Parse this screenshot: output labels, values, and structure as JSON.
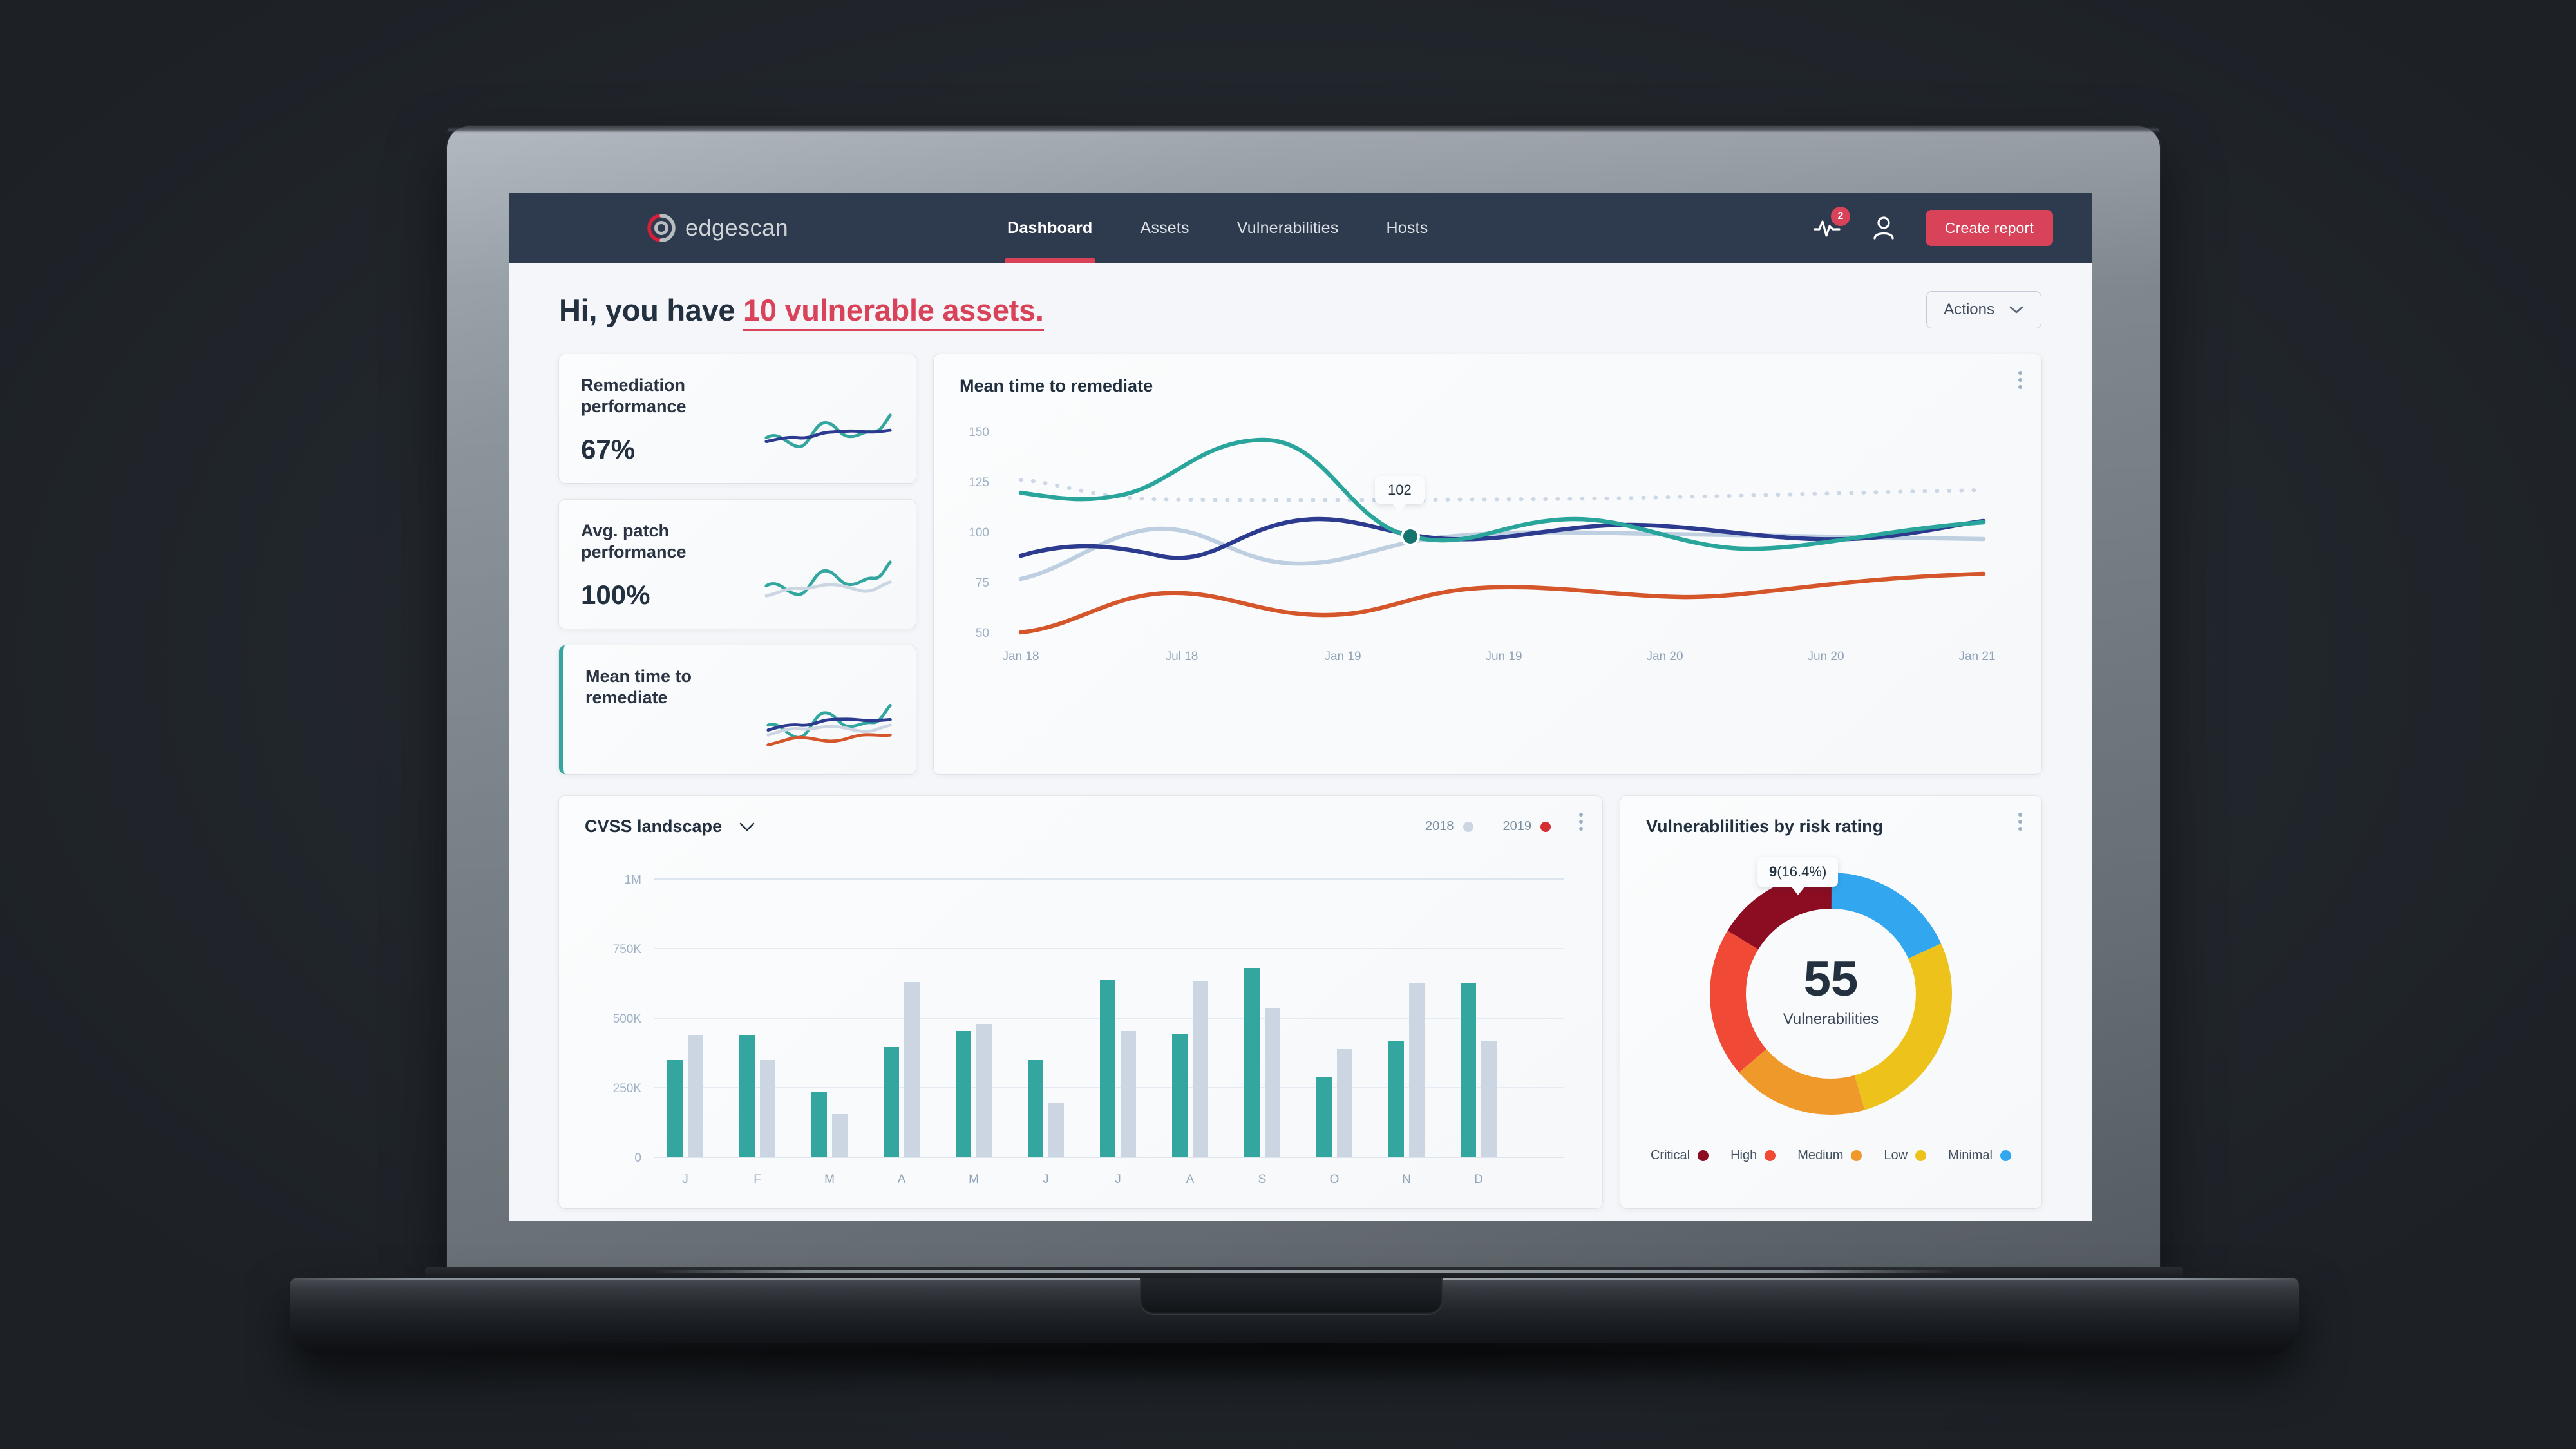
{
  "brand": {
    "name": "edgescan",
    "tm": "™"
  },
  "nav": {
    "items": [
      {
        "label": "Dashboard",
        "active": true
      },
      {
        "label": "Assets",
        "active": false
      },
      {
        "label": "Vulnerabilities",
        "active": false
      },
      {
        "label": "Hosts",
        "active": false
      }
    ],
    "activity_badge": "2",
    "activity_icon": "pulse-icon",
    "account_icon": "user-icon",
    "create_report_label": "Create report"
  },
  "header": {
    "greeting_prefix": "Hi, you have ",
    "greeting_highlight": "10 vulnerable assets.",
    "actions_label": "Actions"
  },
  "kpis": [
    {
      "title": "Remediation performance",
      "value": "67%",
      "selected": false
    },
    {
      "title": "Avg. patch performance",
      "value": "100%",
      "selected": false
    },
    {
      "title": "Mean time to remediate",
      "value": "",
      "selected": true
    }
  ],
  "mttr_card": {
    "title": "Mean time to remediate",
    "menu_icon": "kebab-menu-icon",
    "tooltip_value": "102"
  },
  "cvss_card": {
    "title": "CVSS landscape",
    "dropdown_icon": "chevron-down-icon",
    "menu_icon": "kebab-menu-icon",
    "legend": [
      {
        "label": "2018",
        "color": "#ccd6e2"
      },
      {
        "label": "2019",
        "color": "#d32f35"
      }
    ]
  },
  "donut_card": {
    "title": "Vulnerablilities by risk rating",
    "menu_icon": "kebab-menu-icon",
    "center_value": "55",
    "center_label": "Vulnerabilities",
    "tooltip": "9 (16.4%)",
    "tooltip_value": "9",
    "tooltip_pct": "(16.4%)"
  },
  "colors": {
    "nav_bg": "#2e3b4e",
    "accent_red": "#d9435a",
    "teal": "#33a6a0",
    "navy": "#2c3b8f",
    "light_blue": "#bdcfe0",
    "orange_line": "#d4562a",
    "critical": "#8c0d21",
    "high": "#f04a36",
    "medium": "#f0992b",
    "low": "#ecc21b",
    "minimal": "#32a7ef"
  },
  "chart_data": [
    {
      "type": "line",
      "title": "Mean time to remediate",
      "xlabel": "",
      "ylabel": "",
      "ylim": [
        40,
        160
      ],
      "yticks": [
        50,
        75,
        100,
        125,
        150
      ],
      "ytick_labels": [
        "50",
        "75",
        "100",
        "125",
        "150"
      ],
      "x": [
        "Jan 18",
        "Jul 18",
        "Jan 19",
        "Jun 19",
        "Jan 20",
        "Jun 20",
        "Jan 21"
      ],
      "grid": false,
      "legend_position": "none",
      "annotations": [
        {
          "text": "102",
          "x": "Jan 20",
          "y": 102,
          "series": "Teal"
        }
      ],
      "series": [
        {
          "name": "Teal",
          "color": "#33a6a0",
          "values": [
            126,
            132,
            140,
            120,
            102,
            112,
            118
          ]
        },
        {
          "name": "Navy",
          "color": "#2c3b8f",
          "values": [
            97,
            101,
            94,
            104,
            106,
            100,
            112
          ]
        },
        {
          "name": "Light blue",
          "color": "#bdcfe0",
          "values": [
            84,
            96,
            92,
            100,
            104,
            99,
            94
          ]
        },
        {
          "name": "Orange",
          "color": "#d4562a",
          "values": [
            61,
            72,
            68,
            78,
            74,
            79,
            82
          ]
        },
        {
          "name": "Dotted target",
          "color": "#ccd8e6",
          "style": "dotted",
          "values": [
            126,
            121,
            121,
            121,
            121,
            122,
            123
          ]
        }
      ]
    },
    {
      "type": "bar",
      "title": "CVSS landscape",
      "categories": [
        "J",
        "F",
        "M",
        "A",
        "M",
        "J",
        "J",
        "A",
        "S",
        "O",
        "N",
        "D"
      ],
      "xlabel": "",
      "ylabel": "",
      "ylim": [
        0,
        1000000
      ],
      "yticks": [
        0,
        250000,
        500000,
        750000,
        1000000
      ],
      "ytick_labels": [
        "0",
        "250K",
        "500K",
        "750K",
        "1M"
      ],
      "grid": true,
      "legend_position": "top-right",
      "series": [
        {
          "name": "2019",
          "color": "#33a6a0",
          "values": [
            350000,
            440000,
            235000,
            400000,
            455000,
            350000,
            640000,
            445000,
            680000,
            285000,
            420000,
            635000
          ]
        },
        {
          "name": "2018",
          "color": "#ccd6e2",
          "values": [
            440000,
            350000,
            155000,
            630000,
            480000,
            195000,
            455000,
            635000,
            545000,
            390000,
            625000,
            410000
          ]
        }
      ]
    },
    {
      "type": "pie",
      "title": "Vulnerablilities by risk rating",
      "total": 55,
      "center_label": "Vulnerabilities",
      "legend_position": "bottom",
      "labels": [
        "Critical",
        "High",
        "Medium",
        "Low",
        "Minimal"
      ],
      "values": [
        9,
        11,
        10,
        15,
        10
      ],
      "percentages": [
        16.4,
        20.0,
        18.2,
        27.3,
        18.2
      ],
      "colors": [
        "#8c0d21",
        "#f04a36",
        "#f0992b",
        "#ecc21b",
        "#32a7ef"
      ]
    }
  ]
}
